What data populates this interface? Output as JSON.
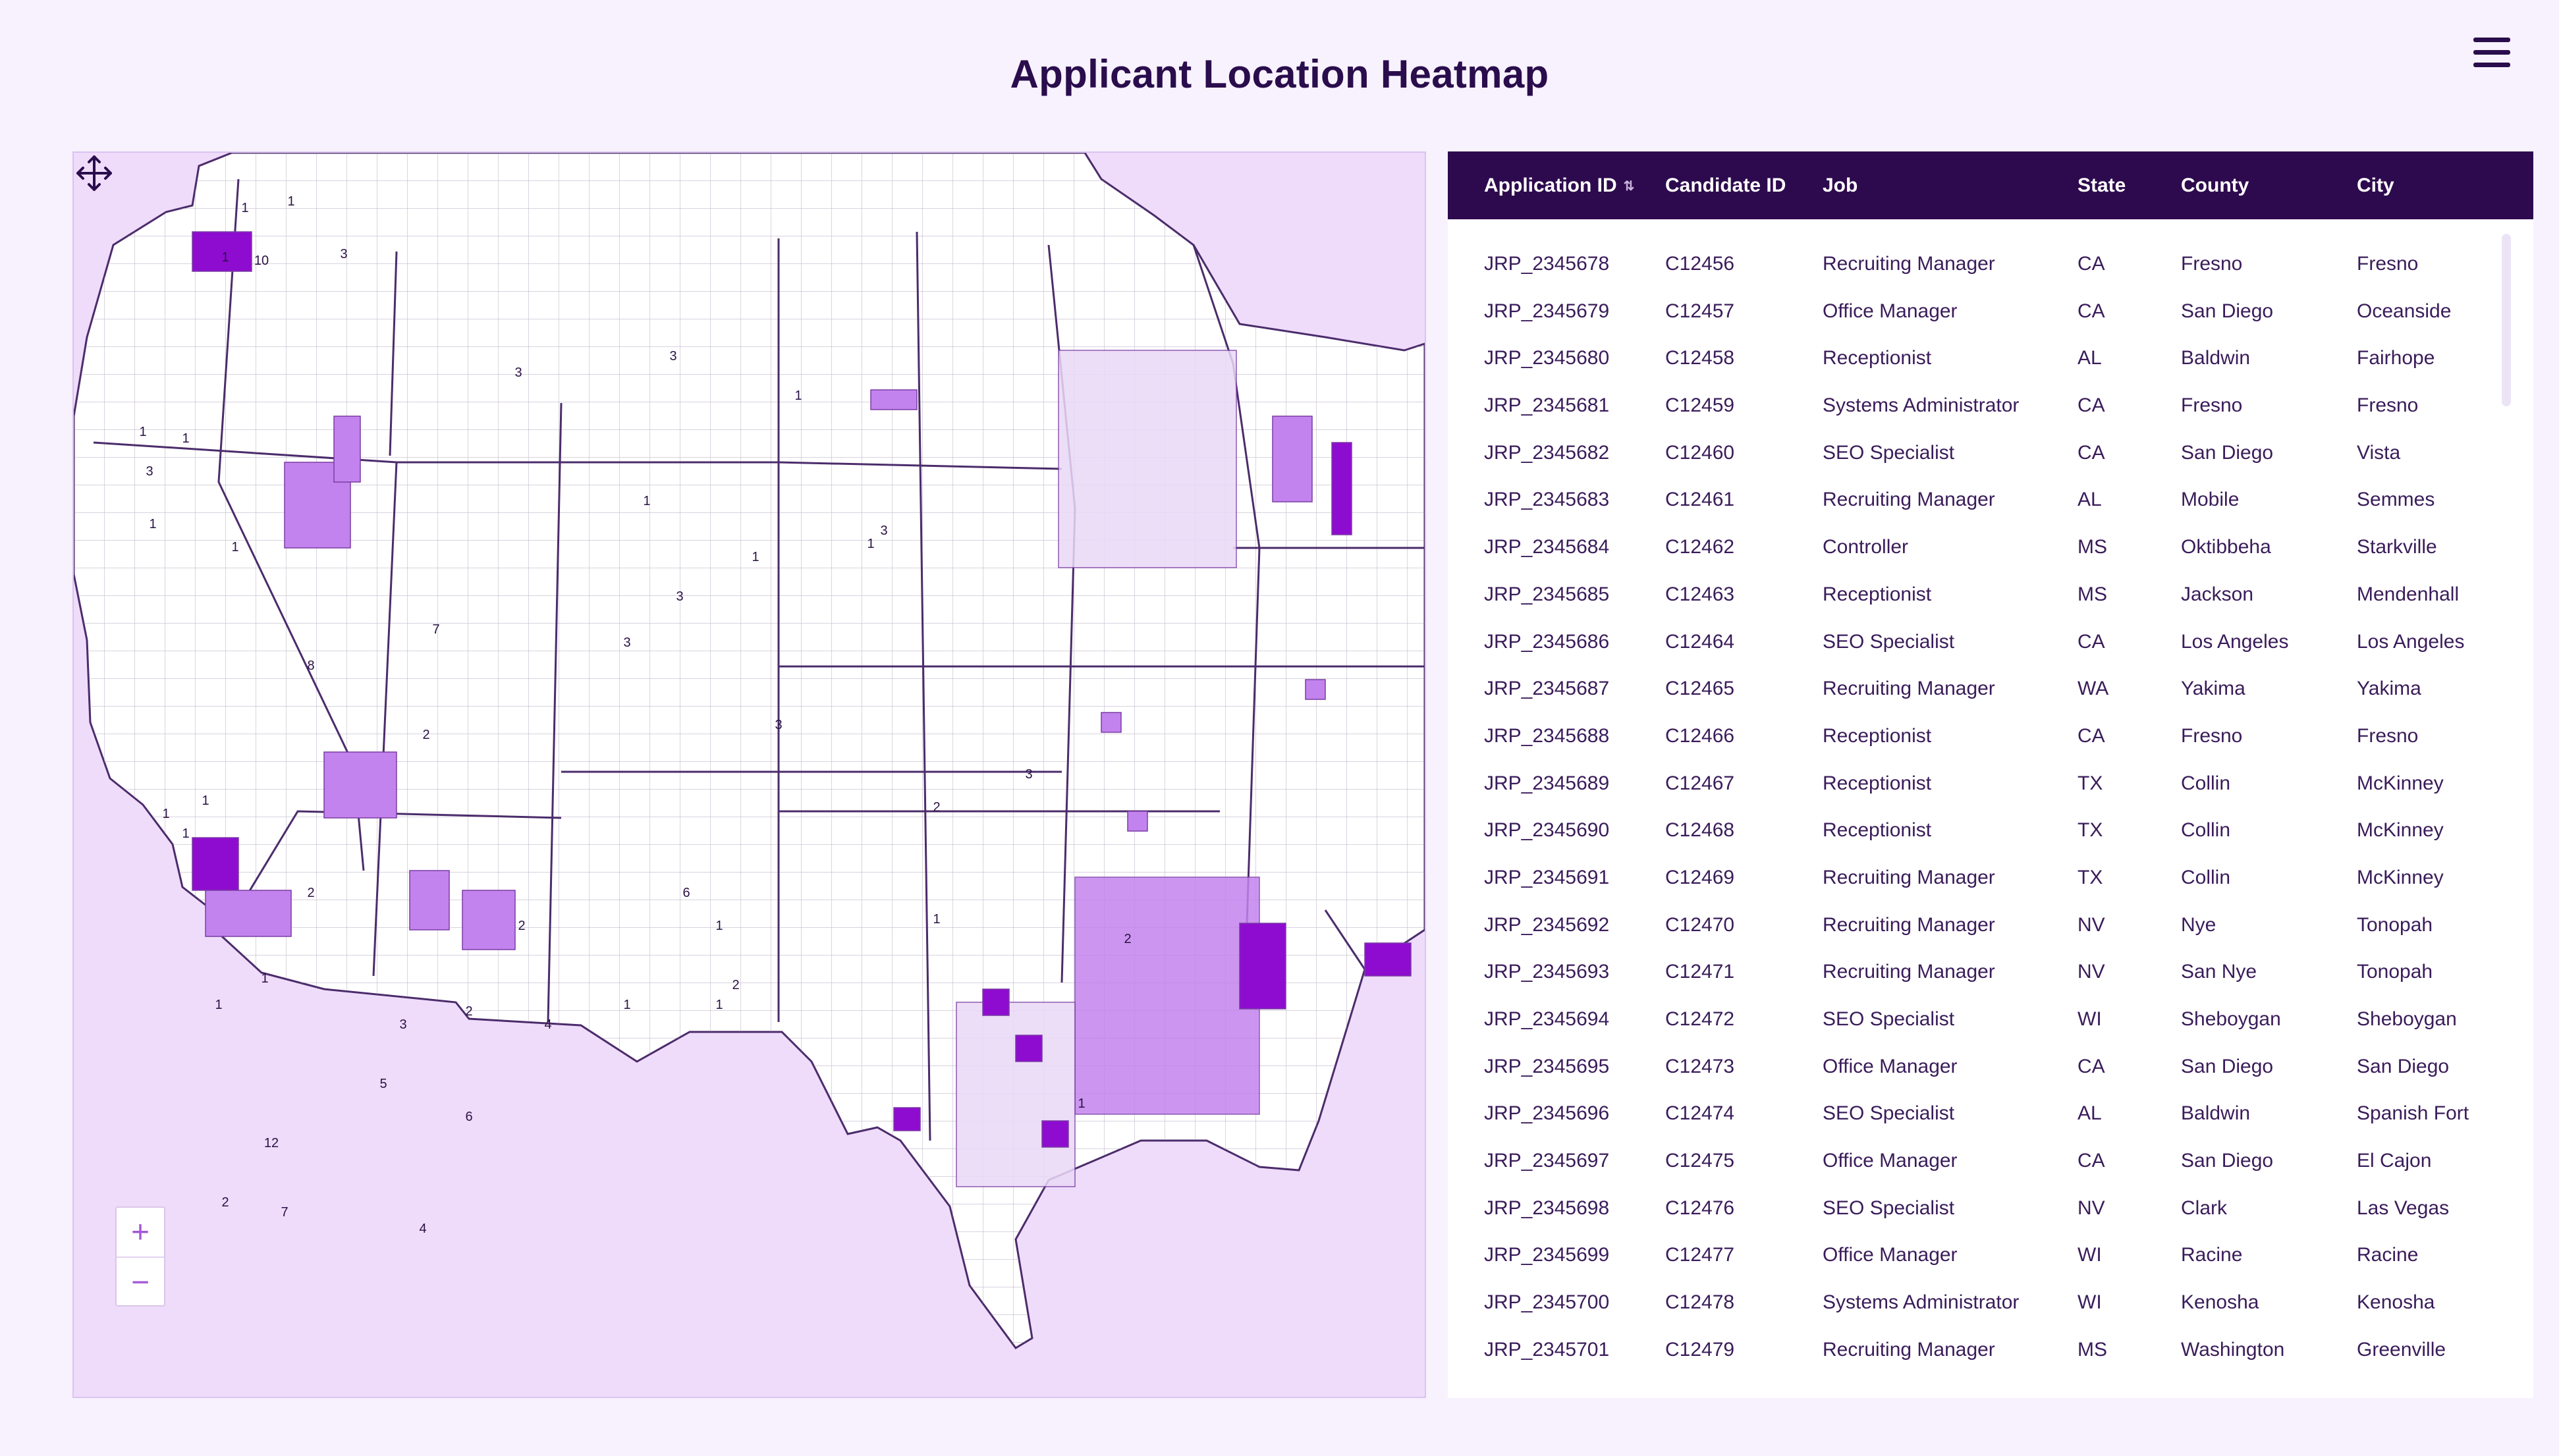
{
  "page": {
    "title": "Applicant Location Heatmap"
  },
  "menu": {
    "icon": "hamburger-menu-icon"
  },
  "colors": {
    "background": "#f7f2fd",
    "header": "#2d0a4e",
    "map_water": "#efdcfb",
    "heat_low": "#ead9f7",
    "heat_mid": "#c383ee",
    "heat_high": "#8e0ccf"
  },
  "map": {
    "zoom_in_label": "+",
    "zoom_out_label": "−",
    "pan_icon": "move-arrows-icon",
    "count_labels": [
      "1",
      "1",
      "1",
      "10",
      "3",
      "3",
      "3",
      "1",
      "1",
      "1",
      "3",
      "3",
      "1",
      "1",
      "1",
      "8",
      "7",
      "2",
      "6",
      "3",
      "2",
      "1",
      "1",
      "2",
      "2",
      "1",
      "2",
      "3",
      "2",
      "3",
      "3",
      "1",
      "1",
      "5",
      "1",
      "3",
      "12",
      "4",
      "7",
      "2",
      "1",
      "4",
      "6",
      "1",
      "1",
      "2",
      "1",
      "1",
      "1"
    ]
  },
  "table": {
    "columns": [
      "Application ID",
      "Candidate ID",
      "Job",
      "State",
      "County",
      "City"
    ],
    "sort_icon": "sort-icon",
    "rows": [
      [
        "JRP_2345678",
        "C12456",
        "Recruiting Manager",
        "CA",
        "Fresno",
        "Fresno"
      ],
      [
        "JRP_2345679",
        "C12457",
        "Office Manager",
        "CA",
        "San Diego",
        "Oceanside"
      ],
      [
        "JRP_2345680",
        "C12458",
        "Receptionist",
        "AL",
        "Baldwin",
        "Fairhope"
      ],
      [
        "JRP_2345681",
        "C12459",
        "Systems Administrator",
        "CA",
        "Fresno",
        "Fresno"
      ],
      [
        "JRP_2345682",
        "C12460",
        "SEO Specialist",
        "CA",
        "San Diego",
        "Vista"
      ],
      [
        "JRP_2345683",
        "C12461",
        "Recruiting Manager",
        "AL",
        "Mobile",
        "Semmes"
      ],
      [
        "JRP_2345684",
        "C12462",
        "Controller",
        "MS",
        "Oktibbeha",
        "Starkville"
      ],
      [
        "JRP_2345685",
        "C12463",
        "Receptionist",
        "MS",
        "Jackson",
        "Mendenhall"
      ],
      [
        "JRP_2345686",
        "C12464",
        "SEO Specialist",
        "CA",
        "Los Angeles",
        "Los Angeles"
      ],
      [
        "JRP_2345687",
        "C12465",
        "Recruiting Manager",
        "WA",
        "Yakima",
        "Yakima"
      ],
      [
        "JRP_2345688",
        "C12466",
        "Receptionist",
        "CA",
        "Fresno",
        "Fresno"
      ],
      [
        "JRP_2345689",
        "C12467",
        "Receptionist",
        "TX",
        "Collin",
        "McKinney"
      ],
      [
        "JRP_2345690",
        "C12468",
        "Receptionist",
        "TX",
        "Collin",
        "McKinney"
      ],
      [
        "JRP_2345691",
        "C12469",
        "Recruiting Manager",
        "TX",
        "Collin",
        "McKinney"
      ],
      [
        "JRP_2345692",
        "C12470",
        "Recruiting Manager",
        "NV",
        "Nye",
        "Tonopah"
      ],
      [
        "JRP_2345693",
        "C12471",
        "Recruiting Manager",
        "NV",
        "San Nye",
        "Tonopah"
      ],
      [
        "JRP_2345694",
        "C12472",
        "SEO Specialist",
        "WI",
        "Sheboygan",
        "Sheboygan"
      ],
      [
        "JRP_2345695",
        "C12473",
        "Office Manager",
        "CA",
        "San Diego",
        "San Diego"
      ],
      [
        "JRP_2345696",
        "C12474",
        "SEO Specialist",
        "AL",
        "Baldwin",
        "Spanish Fort"
      ],
      [
        "JRP_2345697",
        "C12475",
        "Office Manager",
        "CA",
        "San Diego",
        "El Cajon"
      ],
      [
        "JRP_2345698",
        "C12476",
        "SEO Specialist",
        "NV",
        "Clark",
        "Las Vegas"
      ],
      [
        "JRP_2345699",
        "C12477",
        "Office Manager",
        "WI",
        "Racine",
        "Racine"
      ],
      [
        "JRP_2345700",
        "C12478",
        "Systems Administrator",
        "WI",
        "Kenosha",
        "Kenosha"
      ],
      [
        "JRP_2345701",
        "C12479",
        "Recruiting Manager",
        "MS",
        "Washington",
        "Greenville"
      ]
    ]
  }
}
